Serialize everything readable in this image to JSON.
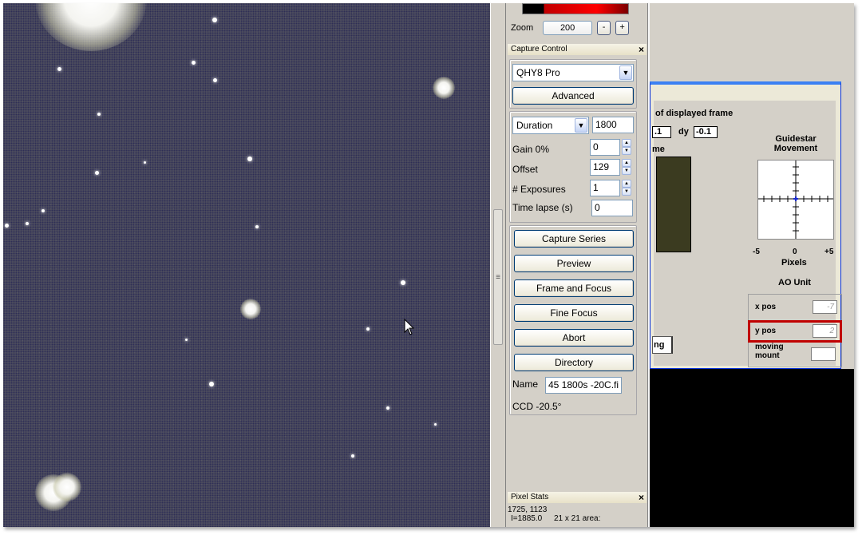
{
  "histogram": {
    "label": ""
  },
  "zoom": {
    "label": "Zoom",
    "value": "200",
    "minus": "-",
    "plus": "+"
  },
  "capture_control": {
    "title": "Capture Control",
    "close": "×",
    "camera": "QHY8 Pro",
    "advanced": "Advanced",
    "duration_mode": "Duration",
    "duration_value": "1800",
    "gain_label": "Gain 0%",
    "gain_value": "0",
    "offset_label": "Offset",
    "offset_value": "129",
    "exposures_label": "# Exposures",
    "exposures_value": "1",
    "timelapse_label": "Time lapse (s)",
    "timelapse_value": "0",
    "buttons": [
      "Capture Series",
      "Preview",
      "Frame and Focus",
      "Fine Focus",
      "Abort",
      "Directory"
    ],
    "name_label": "Name",
    "name_value": "45 1800s -20C.fi",
    "ccd_temp": "CCD -20.5°"
  },
  "pixel_stats": {
    "title": "Pixel Stats",
    "close": "×",
    "coords": "1725, 1123",
    "intensity": "I=1885.0",
    "area": "21 x 21 area:"
  },
  "guide_dialog": {
    "header": "of displayed frame",
    "dx_value": ".1",
    "dy_label": "dy",
    "dy_value": "-0.1",
    "me_label": "me",
    "guidestar_title": "Guidestar",
    "guidestar_sub": "Movement",
    "axis_min": "-5",
    "axis_zero": "0",
    "axis_max": "+5",
    "axis_label": "Pixels",
    "ao_title": "AO Unit",
    "x_pos_label": "x pos",
    "x_pos_value": "-7",
    "y_pos_label": "y pos",
    "y_pos_value": "2",
    "moving_label_1": "moving",
    "moving_label_2": "mount",
    "moving_value": "",
    "partial_button": "ng"
  },
  "colors": {
    "image_bg": "#4d4d5e",
    "highlight": "#c00000",
    "panel": "#d4d0c8"
  }
}
